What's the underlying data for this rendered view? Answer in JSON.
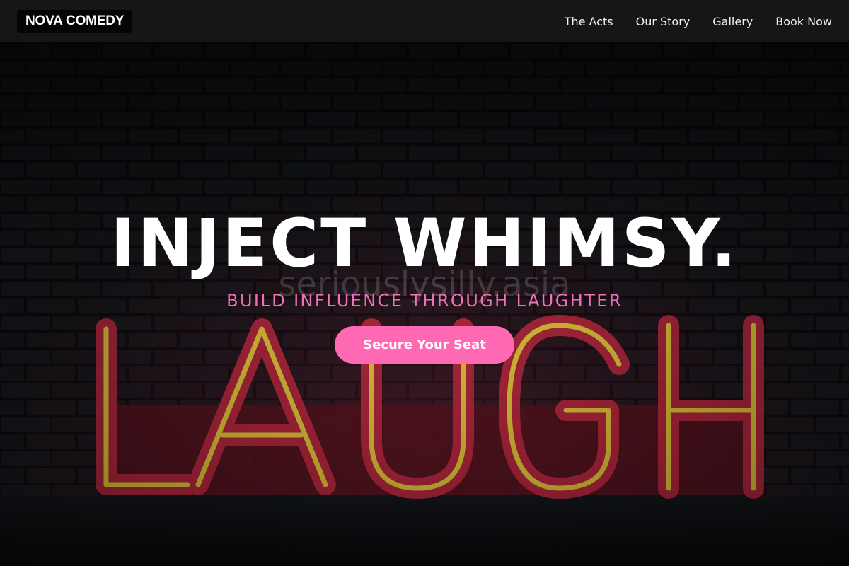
{
  "brand": {
    "name": "NOVA COMEDY"
  },
  "nav": {
    "links": [
      {
        "label": "The Acts"
      },
      {
        "label": "Our Story"
      },
      {
        "label": "Gallery"
      },
      {
        "label": "Book Now"
      }
    ]
  },
  "hero": {
    "headline": "INJECT WHIMSY.",
    "tagline": "BUILD INFLUENCE THROUGH LAUGHTER",
    "cta_label": "Secure Your Seat",
    "background": {
      "description_icon": "neon-laugh-sign-image",
      "sign_text": "LAUGH",
      "watermark": "seriouslysilly.asia"
    }
  },
  "colors": {
    "accent": "#ff69b4",
    "tagline": "#f06fb9",
    "nav_bg": "#161616",
    "neon_tube": "#e8d23a",
    "neon_body": "#b8233a"
  }
}
